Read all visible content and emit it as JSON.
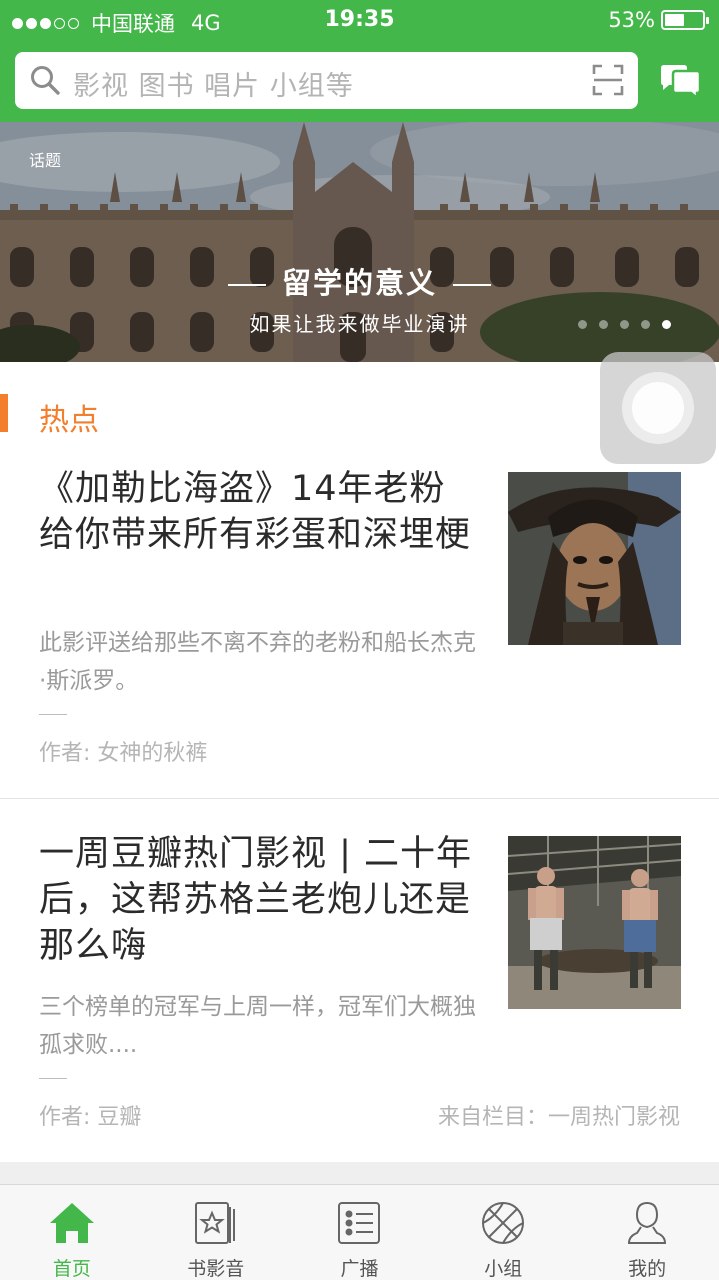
{
  "status_bar": {
    "carrier": "中国联通",
    "network": "4G",
    "time": "19:35",
    "battery_percent_text": "53%",
    "battery_level": 0.53
  },
  "search": {
    "placeholder": "影视 图书 唱片 小组等"
  },
  "banner": {
    "tag": "话题",
    "title": "留学的意义",
    "subtitle": "如果让我来做毕业演讲",
    "dots_total": 5,
    "active_dot": 4
  },
  "section": {
    "title": "热点"
  },
  "articles": [
    {
      "title": "《加勒比海盗》14年老粉给你带来所有彩蛋和深埋梗",
      "desc": "此影评送给那些不离不弃的老粉和船长杰克·斯派罗。",
      "author": "作者: 女神的秋裤",
      "column": ""
    },
    {
      "title": "一周豆瓣热门影视 | 二十年后，这帮苏格兰老炮儿还是那么嗨",
      "desc": "三个榜单的冠军与上周一样，冠军们大概独孤求败....",
      "author": "作者: 豆瓣",
      "column": "来自栏目：一周热门影视"
    }
  ],
  "tabs": [
    {
      "label": "首页",
      "icon": "home-icon",
      "active": true
    },
    {
      "label": "书影音",
      "icon": "book-movie-music-icon",
      "active": false
    },
    {
      "label": "广播",
      "icon": "broadcast-icon",
      "active": false
    },
    {
      "label": "小组",
      "icon": "group-ball-icon",
      "active": false
    },
    {
      "label": "我的",
      "icon": "person-icon",
      "active": false
    }
  ],
  "colors": {
    "brand_green": "#44b74a",
    "accent_orange": "#f37e2b",
    "muted_text": "#9a9a9a"
  }
}
